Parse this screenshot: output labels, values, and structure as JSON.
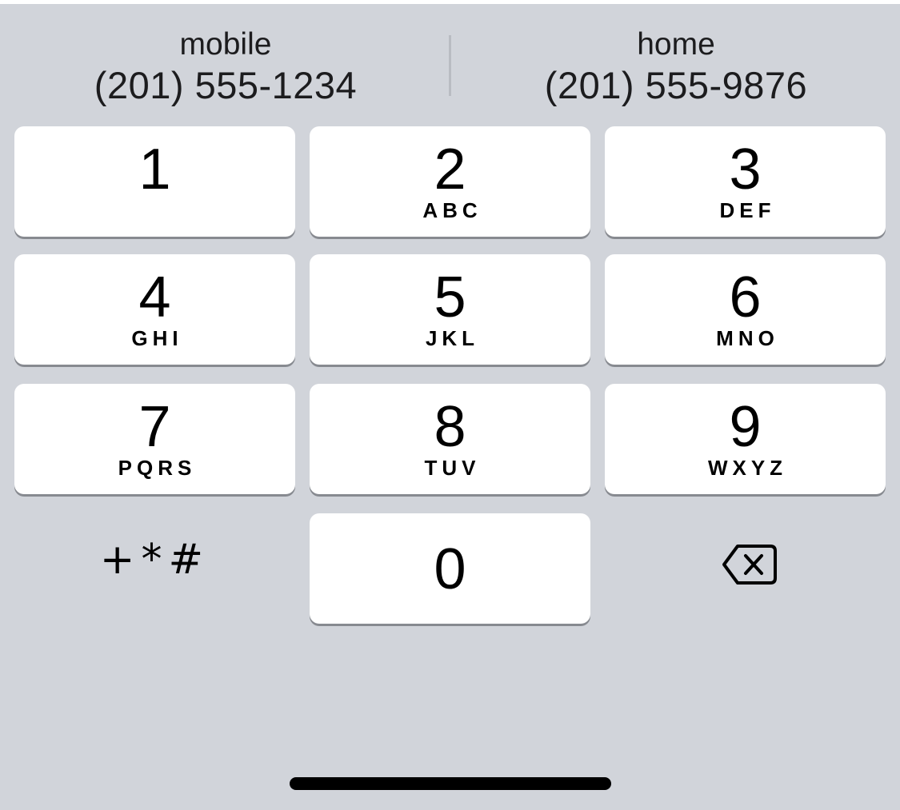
{
  "suggestions": [
    {
      "label": "mobile",
      "number": "(201) 555-1234"
    },
    {
      "label": "home",
      "number": "(201) 555-9876"
    }
  ],
  "keys": [
    {
      "digit": "1",
      "letters": ""
    },
    {
      "digit": "2",
      "letters": "ABC"
    },
    {
      "digit": "3",
      "letters": "DEF"
    },
    {
      "digit": "4",
      "letters": "GHI"
    },
    {
      "digit": "5",
      "letters": "JKL"
    },
    {
      "digit": "6",
      "letters": "MNO"
    },
    {
      "digit": "7",
      "letters": "PQRS"
    },
    {
      "digit": "8",
      "letters": "TUV"
    },
    {
      "digit": "9",
      "letters": "WXYZ"
    },
    {
      "digit": "0",
      "letters": ""
    }
  ],
  "symbols_key": {
    "label": "+*#"
  },
  "backspace_key": {
    "icon": "backspace-icon"
  },
  "colors": {
    "panel_background": "#d1d4da",
    "key_background": "#ffffff",
    "key_shadow": "#878a90"
  }
}
